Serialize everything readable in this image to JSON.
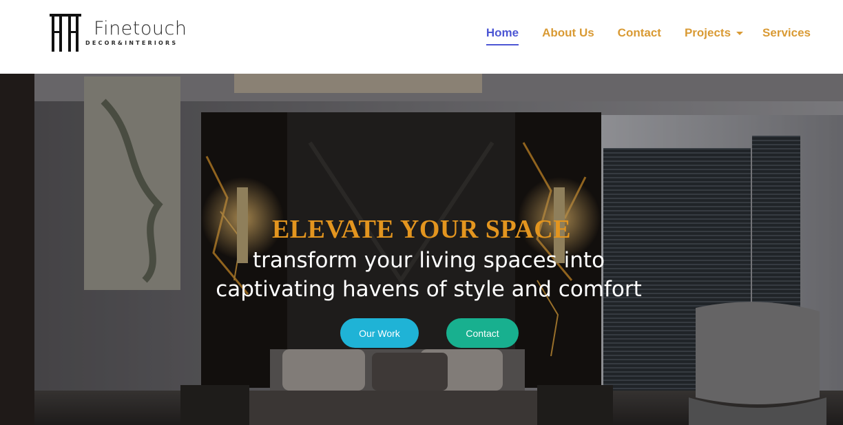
{
  "brand": {
    "name": "Finetouch",
    "tagline": "DECOR&INTERIORS"
  },
  "nav": {
    "home": "Home",
    "about": "About Us",
    "contact": "Contact",
    "projects": "Projects",
    "services": "Services",
    "active": "Home"
  },
  "hero": {
    "title": "ELEVATE YOUR SPACE",
    "subtitle_line1": "transform your living spaces into",
    "subtitle_line2": "captivating havens of style and comfort",
    "primary_button": "Our Work",
    "secondary_button": "Contact"
  },
  "colors": {
    "nav_text": "#d99a34",
    "nav_active": "#4c56d4",
    "title": "#e3951f",
    "primary_button": "#1fb3d6",
    "secondary_button": "#18b08f"
  }
}
